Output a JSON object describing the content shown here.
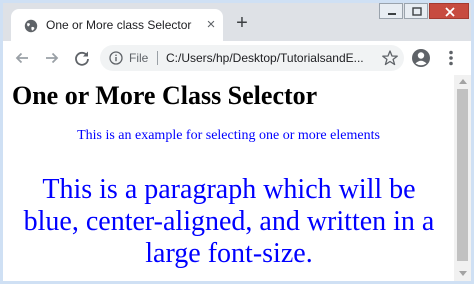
{
  "browser": {
    "tab": {
      "title": "One or More class Selector",
      "close_glyph": "×"
    },
    "new_tab_glyph": "+",
    "address_bar": {
      "scheme_label": "File",
      "url": "C:/Users/hp/Desktop/TutorialsandE..."
    },
    "icons": [
      "globe-icon",
      "close-icon",
      "plus-icon",
      "minimize-icon",
      "maximize-icon",
      "window-close-icon",
      "back-arrow-icon",
      "forward-arrow-icon",
      "reload-icon",
      "info-icon",
      "star-icon",
      "account-icon",
      "menu-icon"
    ]
  },
  "page": {
    "heading": "One or More Class Selector",
    "paragraph_small": "This is an example for selecting one or more elements",
    "paragraph_large": "This is a paragraph which will be blue, center-aligned, and written in a large font-size."
  },
  "colors": {
    "text_blue": "#0000ff",
    "chrome_bg": "#dee1e6",
    "window_close": "#c74b40"
  }
}
